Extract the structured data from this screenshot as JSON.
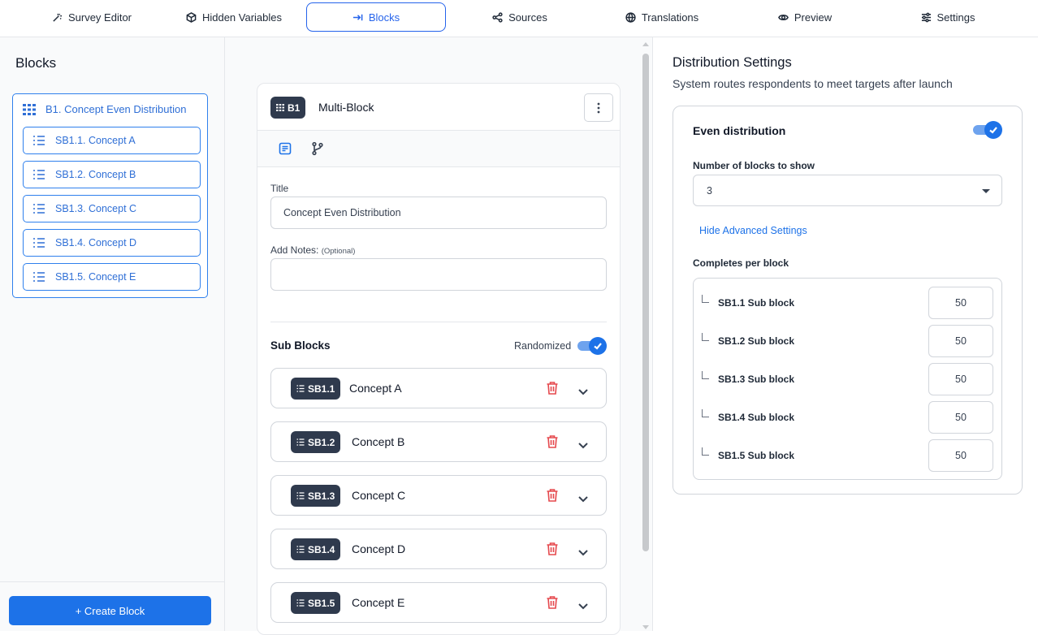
{
  "nav": {
    "tabs": [
      {
        "label": "Survey Editor",
        "icon": "magic-wand-icon"
      },
      {
        "label": "Hidden Variables",
        "icon": "cube-icon"
      },
      {
        "label": "Blocks",
        "icon": "arrow-right-to-line-icon",
        "active": true
      },
      {
        "label": "Sources",
        "icon": "share-nodes-icon"
      },
      {
        "label": "Translations",
        "icon": "globe-icon"
      },
      {
        "label": "Preview",
        "icon": "eye-icon"
      },
      {
        "label": "Settings",
        "icon": "sliders-icon"
      }
    ]
  },
  "sidebar": {
    "title": "Blocks",
    "block": {
      "label": "B1. Concept Even Distribution",
      "icon": "grid-icon"
    },
    "items": [
      {
        "label": "SB1.1. Concept A",
        "icon": "list-icon"
      },
      {
        "label": "SB1.2. Concept B",
        "icon": "list-icon"
      },
      {
        "label": "SB1.3. Concept C",
        "icon": "list-icon"
      },
      {
        "label": "SB1.4. Concept D",
        "icon": "list-icon"
      },
      {
        "label": "SB1.5. Concept E",
        "icon": "list-icon"
      }
    ],
    "create_button": "+ Create Block"
  },
  "editor": {
    "badge": "B1",
    "type_label": "Multi-Block",
    "title_label": "Title",
    "title_value": "Concept Even Distribution",
    "notes_label": "Add Notes:",
    "notes_optional": "(Optional)",
    "notes_value": "",
    "sub_blocks_title": "Sub Blocks",
    "randomized_label": "Randomized",
    "randomized": true,
    "sub_blocks": [
      {
        "badge": "SB1.1",
        "name": "Concept A"
      },
      {
        "badge": "SB1.2",
        "name": "Concept B"
      },
      {
        "badge": "SB1.3",
        "name": "Concept C"
      },
      {
        "badge": "SB1.4",
        "name": "Concept D"
      },
      {
        "badge": "SB1.5",
        "name": "Concept E"
      }
    ]
  },
  "distribution": {
    "title": "Distribution Settings",
    "subtitle": "System routes respondents to meet targets after launch",
    "even_label": "Even distribution",
    "even_enabled": true,
    "blocks_to_show_label": "Number of blocks to show",
    "blocks_to_show_value": "3",
    "advanced_link": "Hide Advanced Settings",
    "completes_label": "Completes per block",
    "completes": [
      {
        "label": "SB1.1 Sub block",
        "value": "50"
      },
      {
        "label": "SB1.2 Sub block",
        "value": "50"
      },
      {
        "label": "SB1.3 Sub block",
        "value": "50"
      },
      {
        "label": "SB1.4 Sub block",
        "value": "50"
      },
      {
        "label": "SB1.5 Sub block",
        "value": "50"
      }
    ]
  },
  "colors": {
    "accent": "#1d72e8",
    "badge": "#2f3a4d",
    "danger": "#e5484d"
  }
}
